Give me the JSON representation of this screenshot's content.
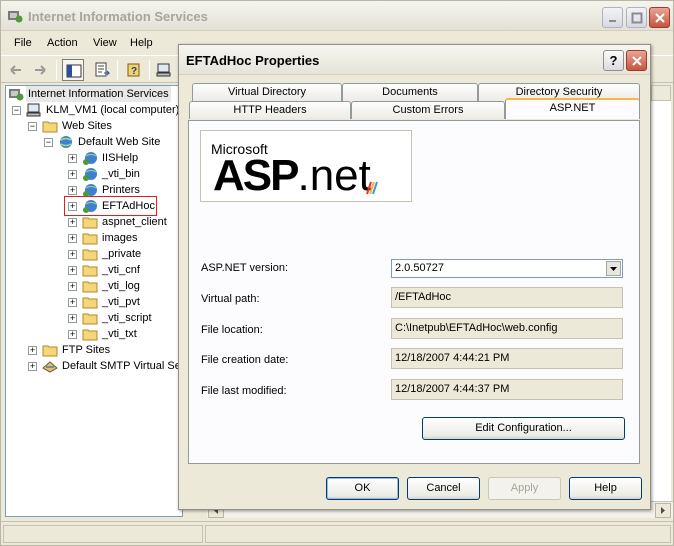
{
  "main_window": {
    "title": "Internet Information Services",
    "menu": [
      "File",
      "Action",
      "View",
      "Help"
    ]
  },
  "tree": {
    "root": "Internet Information Services",
    "computer": "KLM_VM1 (local computer)",
    "web_sites": "Web Sites",
    "default_web_site": "Default Web Site",
    "children": [
      "IISHelp",
      "_vti_bin",
      "Printers",
      "EFTAdHoc",
      "aspnet_client",
      "images",
      "_private",
      "_vti_cnf",
      "_vti_log",
      "_vti_pvt",
      "_vti_script",
      "_vti_txt"
    ],
    "ftp_sites": "FTP Sites",
    "smtp": "Default SMTP Virtual Ser"
  },
  "dialog": {
    "title": "EFTAdHoc Properties",
    "help_glyph": "?",
    "tabs_row1": [
      "Virtual Directory",
      "Documents",
      "Directory Security"
    ],
    "tabs_row2": [
      "HTTP Headers",
      "Custom Errors",
      "ASP.NET"
    ],
    "logo": {
      "small": "Microsoft",
      "big": "ASP",
      "net": ".net"
    },
    "fields": {
      "version_label": "ASP.NET version:",
      "version_value": "2.0.50727",
      "path_label": "Virtual path:",
      "path_value": "/EFTAdHoc",
      "location_label": "File location:",
      "location_value": "C:\\Inetpub\\EFTAdHoc\\web.config",
      "created_label": "File creation date:",
      "created_value": "12/18/2007 4:44:21 PM",
      "modified_label": "File last modified:",
      "modified_value": "12/18/2007 4:44:37 PM"
    },
    "edit_config": "Edit Configuration...",
    "buttons": {
      "ok": "OK",
      "cancel": "Cancel",
      "apply": "Apply",
      "help": "Help"
    }
  },
  "colors": {
    "highlight_box": "#e02020",
    "tab_active_accent": "#f9b545",
    "button_border": "#003c74"
  }
}
